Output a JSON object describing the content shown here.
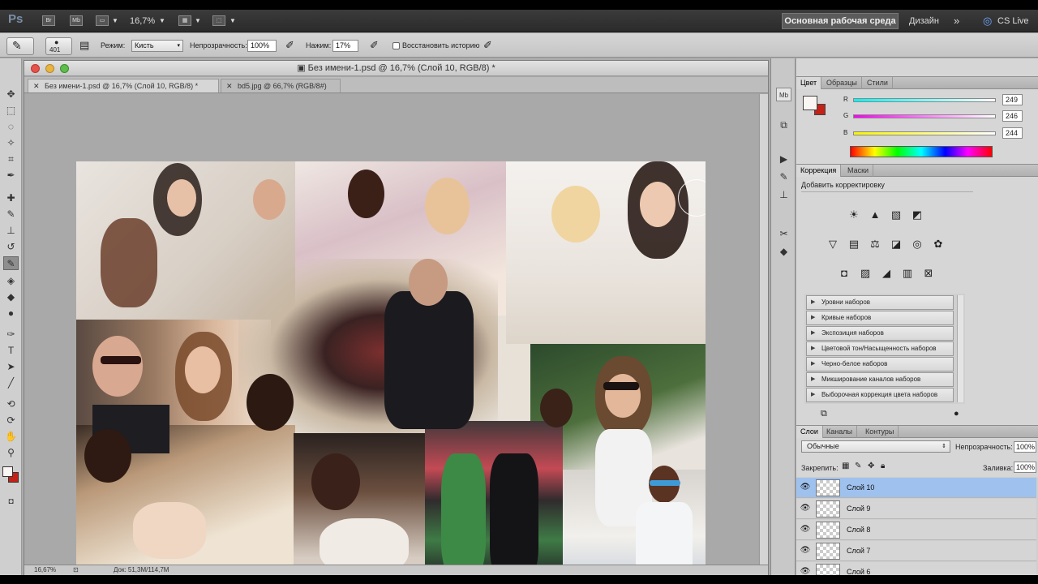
{
  "app": {
    "logo": "Ps",
    "zoom": "16,7%",
    "workspaces": [
      "Основная рабочая среда",
      "Дизайн"
    ],
    "more": "»",
    "cslive": "CS Live"
  },
  "options": {
    "brush_size": "401",
    "mode_label": "Режим:",
    "mode_value": "Кисть",
    "opacity_label": "Непрозрачность:",
    "opacity_value": "100%",
    "pressure_label": "Нажим:",
    "pressure_value": "17%",
    "restore_label": "Восстановить историю"
  },
  "document": {
    "title": "Без имени-1.psd @ 16,7% (Слой 10, RGB/8) *",
    "tabs": [
      "Без имени-1.psd @ 16,7% (Слой 10, RGB/8) *",
      "bd5.jpg @ 66,7% (RGB/8#)"
    ],
    "status_zoom": "16,67%",
    "status_doc": "Док: 51,3M/114,7M"
  },
  "color_panel": {
    "tabs": [
      "Цвет",
      "Образцы",
      "Стили"
    ],
    "channels": [
      {
        "label": "R",
        "value": "249"
      },
      {
        "label": "G",
        "value": "246"
      },
      {
        "label": "B",
        "value": "244"
      }
    ],
    "foreground": "#f9f6f4",
    "background": "#c42217"
  },
  "adjustments_panel": {
    "tabs": [
      "Коррекция",
      "Маски"
    ],
    "heading": "Добавить корректировку",
    "presets": [
      "Уровни наборов",
      "Кривые наборов",
      "Экспозиция наборов",
      "Цветовой тон/Насыщенность наборов",
      "Черно-белое наборов",
      "Микширование каналов наборов",
      "Выборочная коррекция цвета наборов"
    ]
  },
  "layers_panel": {
    "tabs": [
      "Слои",
      "Каналы",
      "Контуры"
    ],
    "blend_mode": "Обычные",
    "opacity_label": "Непрозрачность:",
    "opacity_value": "100%",
    "lock_label": "Закрепить:",
    "fill_label": "Заливка:",
    "fill_value": "100%",
    "layers": [
      "Слой 10",
      "Слой 9",
      "Слой 8",
      "Слой 7",
      "Слой 6"
    ]
  }
}
